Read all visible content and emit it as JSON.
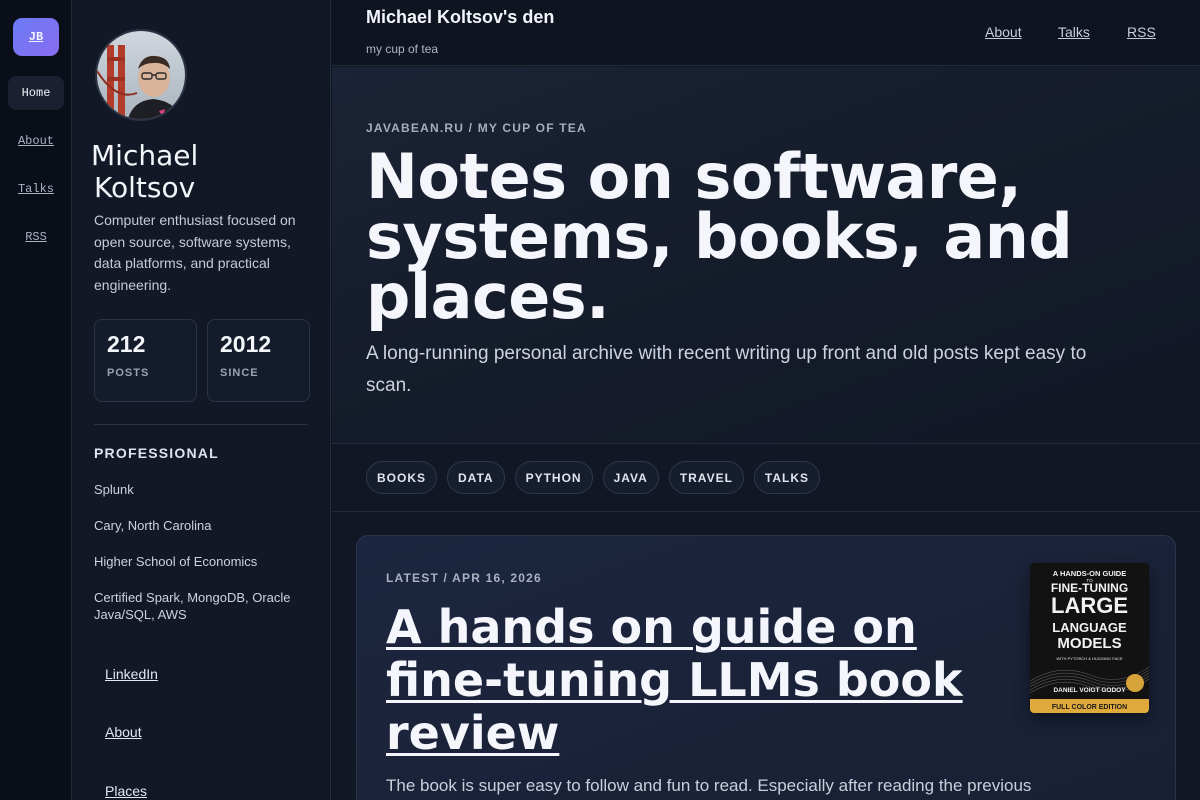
{
  "rail": {
    "logo": "JB",
    "items": [
      {
        "label": "Home",
        "active": true
      },
      {
        "label": "About",
        "active": false
      },
      {
        "label": "Talks",
        "active": false
      },
      {
        "label": "RSS",
        "active": false
      }
    ]
  },
  "profile": {
    "name_first": "Michael",
    "name_last": "Koltsov",
    "bio": "Computer enthusiast focused on open source, software systems, data platforms, and practical engineering.",
    "stats": [
      {
        "value": "212",
        "label": "POSTS"
      },
      {
        "value": "2012",
        "label": "SINCE"
      }
    ],
    "section_title": "PROFESSIONAL",
    "professional": [
      "Splunk",
      "Cary, North Carolina",
      "Higher School of Economics",
      "Certified Spark, MongoDB, Oracle Java/SQL, AWS"
    ],
    "links": [
      "LinkedIn",
      "About",
      "Places"
    ]
  },
  "header": {
    "title": "Michael Koltsov's den",
    "tagline": "my cup of tea",
    "nav": [
      "About",
      "Talks",
      "RSS"
    ]
  },
  "hero": {
    "eyebrow": "JAVABEAN.RU / MY CUP OF TEA",
    "title": "Notes on software, systems, books, and places.",
    "subtitle": "A long-running personal archive with recent writing up front and old posts kept easy to scan."
  },
  "tags": [
    "BOOKS",
    "DATA",
    "PYTHON",
    "JAVA",
    "TRAVEL",
    "TALKS"
  ],
  "latest": {
    "meta": "LATEST / APR 16, 2026",
    "title": "A hands on guide on fine-tuning LLMs book review",
    "excerpt": "The book is super easy to follow and fun to read. Especially after reading the previous",
    "cover": {
      "line1": "A HANDS-ON GUIDE",
      "line2": "TO",
      "line3": "FINE-TUNING",
      "line4": "LARGE",
      "line5": "LANGUAGE",
      "line6": "MODELS",
      "line7": "WITH PYTORCH & HUGGING FACE",
      "author": "DANIEL VOIGT GODOY",
      "edition": "FULL COLOR EDITION"
    }
  }
}
